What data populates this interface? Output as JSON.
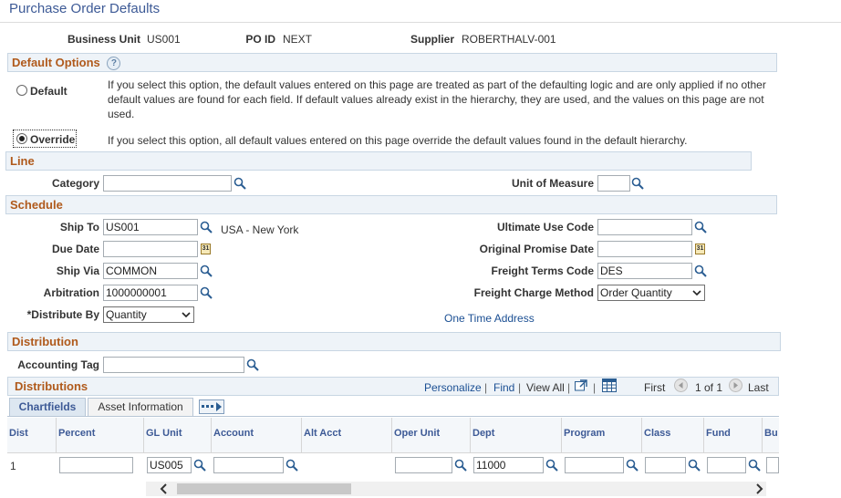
{
  "page": {
    "title": "Purchase Order Defaults"
  },
  "header": {
    "business_unit_label": "Business Unit",
    "business_unit": "US001",
    "po_id_label": "PO ID",
    "po_id": "NEXT",
    "supplier_label": "Supplier",
    "supplier": "ROBERTHALV-001"
  },
  "default_options": {
    "title": "Default Options",
    "help_glyph": "?",
    "default_label": "Default",
    "default_desc": "If you select this option, the default values entered on this page are treated as part of the defaulting logic and are only applied if no other default values are found for each field. If default values already exist in the hierarchy, they are used, and the values on this page are not used.",
    "override_label": "Override",
    "override_desc": "If you select this option, all default values entered on this page override the default values found in the default hierarchy.",
    "selected": "Override"
  },
  "line": {
    "title": "Line",
    "category_label": "Category",
    "category_value": "",
    "uom_label": "Unit of Measure",
    "uom_value": ""
  },
  "schedule": {
    "title": "Schedule",
    "ship_to_label": "Ship To",
    "ship_to": "US001",
    "ship_to_desc": "USA - New York",
    "due_date_label": "Due Date",
    "due_date": "",
    "ship_via_label": "Ship Via",
    "ship_via": "COMMON",
    "arbitration_label": "Arbitration",
    "arbitration": "1000000001",
    "distribute_by_label": "*Distribute By",
    "distribute_by": "Quantity",
    "ultimate_use_label": "Ultimate Use Code",
    "ultimate_use": "",
    "orig_promise_label": "Original Promise Date",
    "orig_promise": "",
    "freight_terms_label": "Freight Terms Code",
    "freight_terms": "DES",
    "freight_charge_label": "Freight Charge Method",
    "freight_charge": "Order Quantity",
    "one_time_address": "One Time Address",
    "calendar_glyph": "31"
  },
  "distribution": {
    "title": "Distribution",
    "accounting_tag_label": "Accounting Tag",
    "accounting_tag": ""
  },
  "distributions_grid": {
    "title": "Distributions",
    "personalize": "Personalize",
    "find": "Find",
    "view_all": "View All",
    "sep": "|",
    "first": "First",
    "range": "1 of 1",
    "last": "Last",
    "tabs": [
      "Chartfields",
      "Asset Information"
    ],
    "columns": [
      "Dist",
      "Percent",
      "GL Unit",
      "Account",
      "Alt Acct",
      "Oper Unit",
      "Dept",
      "Program",
      "Class",
      "Fund",
      "Bu"
    ],
    "row": {
      "dist": "1",
      "percent": "",
      "gl_unit": "US005",
      "account": "",
      "oper_unit": "",
      "dept": "11000",
      "program": "",
      "class": "",
      "fund": ""
    }
  },
  "colors": {
    "section_title": "#b05a1c",
    "link": "#1b4f93",
    "page_title": "#3d5a96"
  }
}
